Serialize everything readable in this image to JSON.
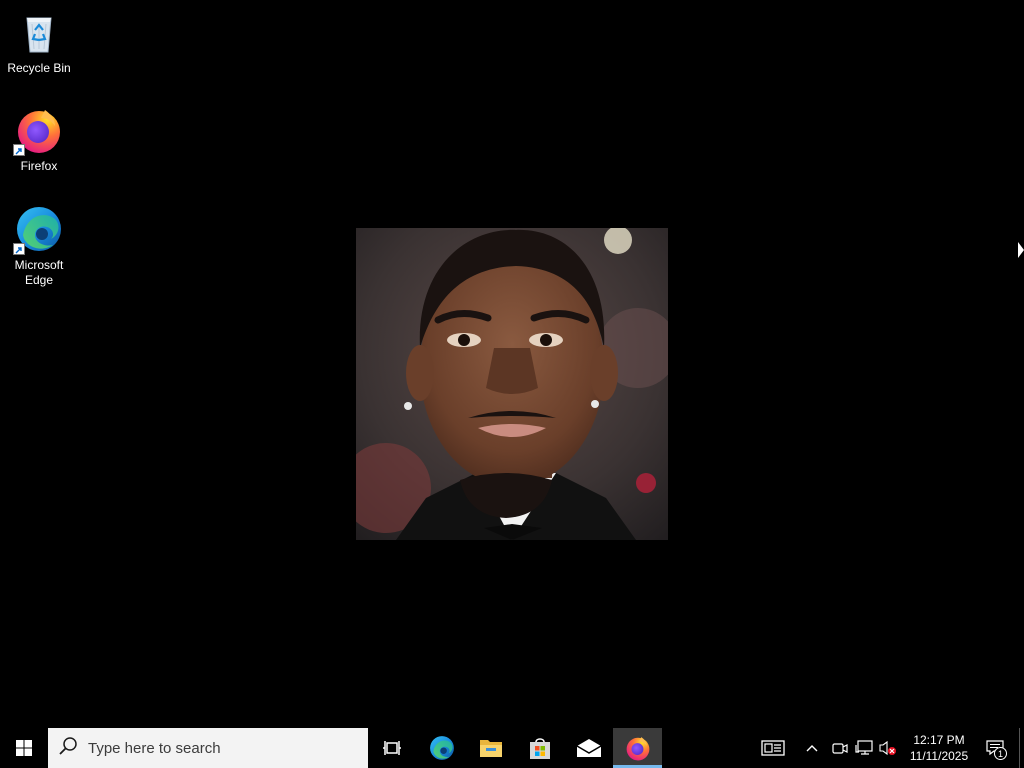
{
  "desktop": {
    "icons": [
      {
        "label": "Recycle Bin",
        "icon": "recycle-bin-icon"
      },
      {
        "label": "Firefox",
        "icon": "firefox-icon"
      },
      {
        "label": "Microsoft\nEdge",
        "icon": "edge-icon"
      }
    ],
    "wallpaper": {
      "type": "portrait-photo",
      "icon": "portrait-photo"
    }
  },
  "taskbar": {
    "start_icon": "windows-logo-icon",
    "search": {
      "placeholder": "Type here to search",
      "icon": "search-icon"
    },
    "pinned": [
      {
        "name": "Task View",
        "icon": "task-view-icon"
      },
      {
        "name": "Microsoft Edge",
        "icon": "edge-icon"
      },
      {
        "name": "File Explorer",
        "icon": "folder-icon"
      },
      {
        "name": "Microsoft Store",
        "icon": "store-icon"
      },
      {
        "name": "Mail",
        "icon": "mail-icon"
      },
      {
        "name": "Firefox",
        "icon": "firefox-icon",
        "active": true
      }
    ],
    "tray": {
      "icons": [
        "news-icon",
        "chevron-up-icon",
        "meet-now-icon",
        "network-icon",
        "volume-muted-icon"
      ],
      "clock": {
        "time": "12:17 PM",
        "date": "11/11/2025"
      },
      "notifications": {
        "count": "1",
        "icon": "notification-icon"
      }
    }
  },
  "colors": {
    "taskbar_bg": "#000000",
    "search_bg": "#f3f3f3",
    "active_underline": "#76b9ed",
    "windows_blue": "#ffffff"
  }
}
